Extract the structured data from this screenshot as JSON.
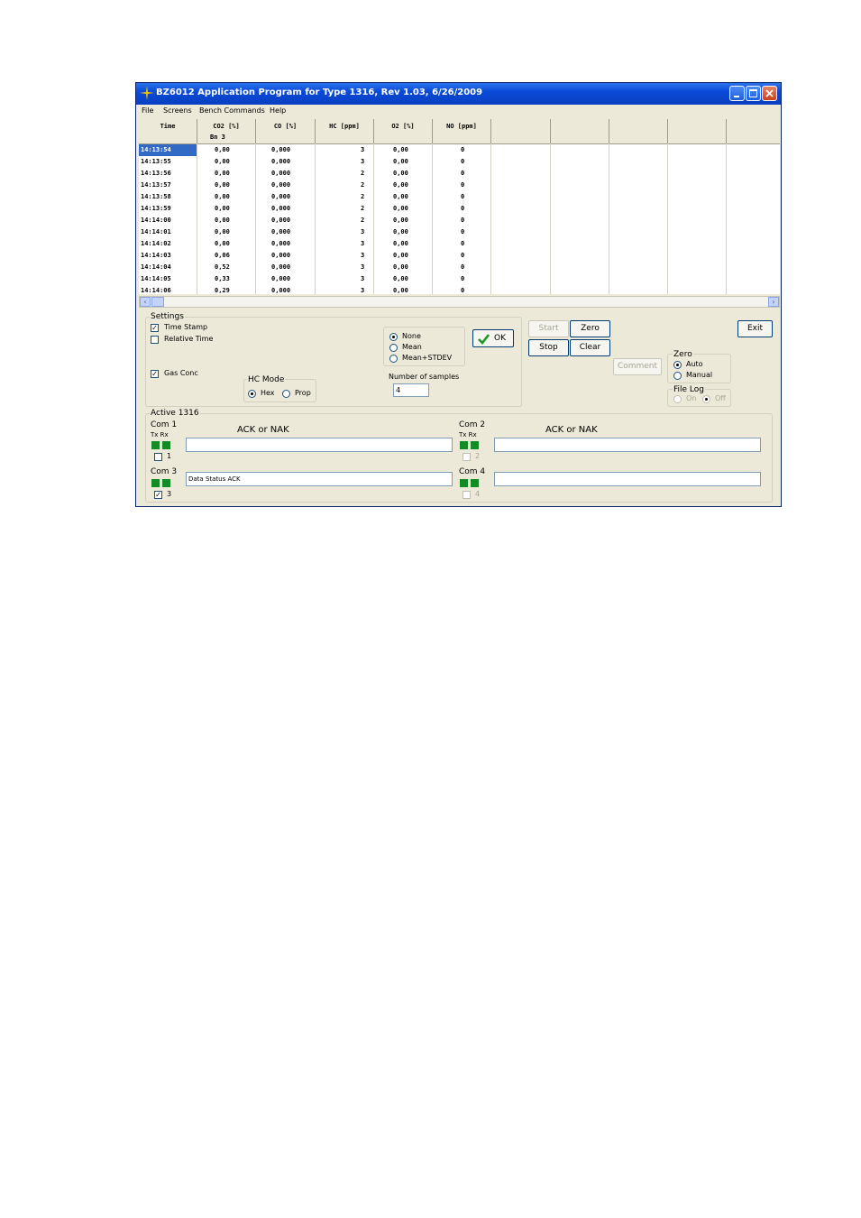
{
  "window": {
    "title": "BZ6012 Application Program for Type 1316, Rev 1.03, 6/26/2009"
  },
  "menu": [
    "File",
    "Screens",
    "Bench Commands",
    "Help"
  ],
  "table": {
    "columns": [
      "Time",
      "CO2 [%]",
      "CO [%]",
      "HC [ppm]",
      "O2 [%]",
      "NO [ppm]"
    ],
    "sub_header": "Bn 3",
    "rows": [
      [
        "14:13:54",
        "0,00",
        "0,000",
        "3",
        "0,00",
        "0"
      ],
      [
        "14:13:55",
        "0,00",
        "0,000",
        "3",
        "0,00",
        "0"
      ],
      [
        "14:13:56",
        "0,00",
        "0,000",
        "2",
        "0,00",
        "0"
      ],
      [
        "14:13:57",
        "0,00",
        "0,000",
        "2",
        "0,00",
        "0"
      ],
      [
        "14:13:58",
        "0,00",
        "0,000",
        "2",
        "0,00",
        "0"
      ],
      [
        "14:13:59",
        "0,00",
        "0,000",
        "2",
        "0,00",
        "0"
      ],
      [
        "14:14:00",
        "0,00",
        "0,000",
        "2",
        "0,00",
        "0"
      ],
      [
        "14:14:01",
        "0,00",
        "0,000",
        "3",
        "0,00",
        "0"
      ],
      [
        "14:14:02",
        "0,00",
        "0,000",
        "3",
        "0,00",
        "0"
      ],
      [
        "14:14:03",
        "0,06",
        "0,000",
        "3",
        "0,00",
        "0"
      ],
      [
        "14:14:04",
        "0,52",
        "0,000",
        "3",
        "0,00",
        "0"
      ],
      [
        "14:14:05",
        "0,33",
        "0,000",
        "3",
        "0,00",
        "0"
      ],
      [
        "14:14:06",
        "0,29",
        "0,000",
        "3",
        "0,00",
        "0"
      ]
    ]
  },
  "settings": {
    "label": "Settings",
    "time_stamp": "Time Stamp",
    "relative_time": "Relative Time",
    "gas_conc": "Gas Conc",
    "hc_mode": {
      "label": "HC Mode",
      "hex": "Hex",
      "prop": "Prop"
    },
    "averaging": {
      "none": "None",
      "mean": "Mean",
      "mean_stdev": "Mean+STDEV"
    },
    "ok": "OK",
    "samples_label": "Number of samples",
    "samples_value": "4"
  },
  "buttons": {
    "start": "Start",
    "stop": "Stop",
    "zero": "Zero",
    "clear": "Clear",
    "exit": "Exit",
    "comment": "Comment"
  },
  "zero_group": {
    "label": "Zero",
    "auto": "Auto",
    "manual": "Manual"
  },
  "file_log": {
    "label": "File Log",
    "on": "On",
    "off": "Off"
  },
  "active": {
    "label": "Active 1316",
    "txrx": "Tx Rx",
    "ack_nak": "ACK or NAK",
    "com1": {
      "label": "Com 1",
      "num": "1",
      "text": ""
    },
    "com2": {
      "label": "Com 2",
      "num": "2",
      "text": ""
    },
    "com3": {
      "label": "Com 3",
      "num": "3",
      "text": "Data Status  ACK"
    },
    "com4": {
      "label": "Com 4",
      "num": "4",
      "text": ""
    }
  },
  "colors": {
    "titlebar": "#0a4ad8",
    "selection": "#316ac5",
    "led": "#138c25",
    "face": "#ece9d8"
  }
}
